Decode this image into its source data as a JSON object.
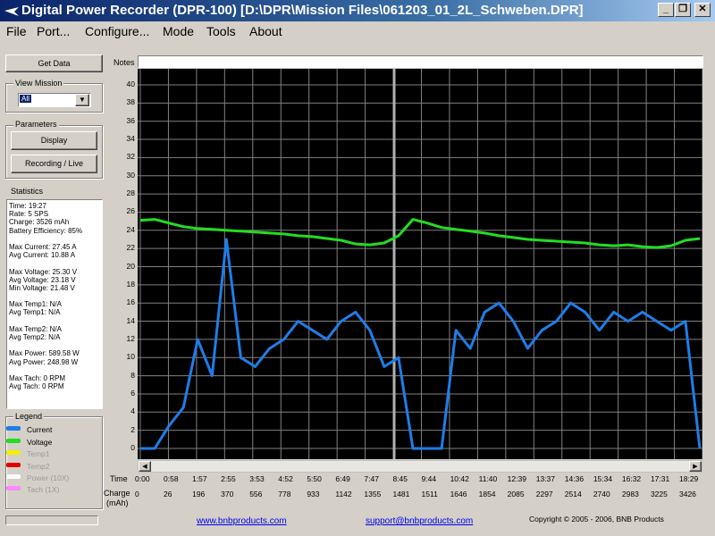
{
  "window": {
    "title": "Digital Power Recorder (DPR-100) [D:\\DPR\\Mission Files\\061203_01_2L_Schweben.DPR]"
  },
  "menu": [
    {
      "label": "File"
    },
    {
      "label": "Port..."
    },
    {
      "label": "Configure..."
    },
    {
      "label": "Mode"
    },
    {
      "label": "Tools"
    },
    {
      "label": "About"
    }
  ],
  "left": {
    "get_data": "Get Data",
    "view_mission_label": "View Mission",
    "view_mission_value": "All",
    "parameters_label": "Parameters",
    "display_button": "Display",
    "recording_button": "Recording / Live",
    "statistics_label": "Statistics",
    "stats": [
      "Time: 19:27",
      "Rate: 5 SPS",
      "Charge: 3526 mAh",
      "Battery Efficiency: 85%",
      "",
      "Max Current: 27.45 A",
      "Avg Current: 10.88 A",
      "",
      "Max Voltage: 25.30 V",
      "Avg Voltage: 23.18 V",
      "Min Voltage: 21.48 V",
      "",
      "Max Temp1: N/A",
      "Avg Temp1: N/A",
      "",
      "Max Temp2: N/A",
      "Avg Temp2: N/A",
      "",
      "Max Power: 589.58 W",
      "Avg Power: 248.98 W",
      "",
      "Max Tach: 0 RPM",
      "Avg Tach: 0 RPM"
    ],
    "legend_label": "Legend",
    "legend": [
      {
        "name": "Current",
        "color": "#1e7ee8",
        "active": true
      },
      {
        "name": "Voltage",
        "color": "#22dd22",
        "active": true
      },
      {
        "name": "Temp1",
        "color": "#f0f000",
        "active": false
      },
      {
        "name": "Temp2",
        "color": "#e00000",
        "active": false
      },
      {
        "name": "Power   (10X)",
        "color": "#ffffff",
        "active": false
      },
      {
        "name": "Tach    (1X)",
        "color": "#ff88ff",
        "active": false
      }
    ]
  },
  "notes_label": "Notes",
  "row_labels": {
    "time": "Time",
    "charge": "Charge",
    "charge_unit": "(mAh)"
  },
  "chart_data": {
    "type": "line",
    "y_ticks": [
      0,
      2,
      4,
      6,
      8,
      10,
      12,
      14,
      16,
      18,
      20,
      22,
      24,
      26,
      28,
      30,
      32,
      34,
      36,
      38,
      40
    ],
    "ylim": [
      0,
      40
    ],
    "grid": true,
    "x_time_labels": [
      "0:00",
      "0:58",
      "1:57",
      "2:55",
      "3:53",
      "4:52",
      "5:50",
      "6:49",
      "7:47",
      "8:45",
      "9:44",
      "10:42",
      "11:40",
      "12:39",
      "13:37",
      "14:36",
      "15:34",
      "16:32",
      "17:31",
      "18:29"
    ],
    "x_charge_labels": [
      "0",
      "26",
      "196",
      "370",
      "556",
      "778",
      "933",
      "1142",
      "1355",
      "1481",
      "1511",
      "1646",
      "1854",
      "2085",
      "2297",
      "2514",
      "2740",
      "2983",
      "3225",
      "3426"
    ],
    "series": [
      {
        "name": "Voltage",
        "color": "#22dd22",
        "values": [
          25.1,
          25.2,
          24.8,
          24.4,
          24.2,
          24.1,
          24.0,
          23.9,
          23.8,
          23.7,
          23.6,
          23.4,
          23.3,
          23.1,
          22.9,
          22.5,
          22.4,
          22.6,
          23.4,
          25.2,
          24.8,
          24.3,
          24.1,
          23.9,
          23.7,
          23.4,
          23.2,
          23.0,
          22.9,
          22.8,
          22.7,
          22.6,
          22.4,
          22.3,
          22.4,
          22.2,
          22.1,
          22.3,
          22.9,
          23.1
        ]
      },
      {
        "name": "Current",
        "color": "#1e7ee8",
        "values": [
          0,
          0,
          2.5,
          4.5,
          12,
          8,
          23,
          10,
          9,
          11,
          12,
          14,
          13,
          12,
          14,
          15,
          13,
          9,
          10,
          0,
          0,
          0,
          13,
          11,
          15,
          16,
          14,
          11,
          13,
          14,
          16,
          15,
          13,
          15,
          14,
          15,
          14,
          13,
          14,
          0
        ]
      }
    ]
  },
  "footer": {
    "link1": "www.bnbproducts.com",
    "link2": "support@bnbproducts.com",
    "copyright": "Copyright © 2005 - 2006, BNB Products"
  }
}
